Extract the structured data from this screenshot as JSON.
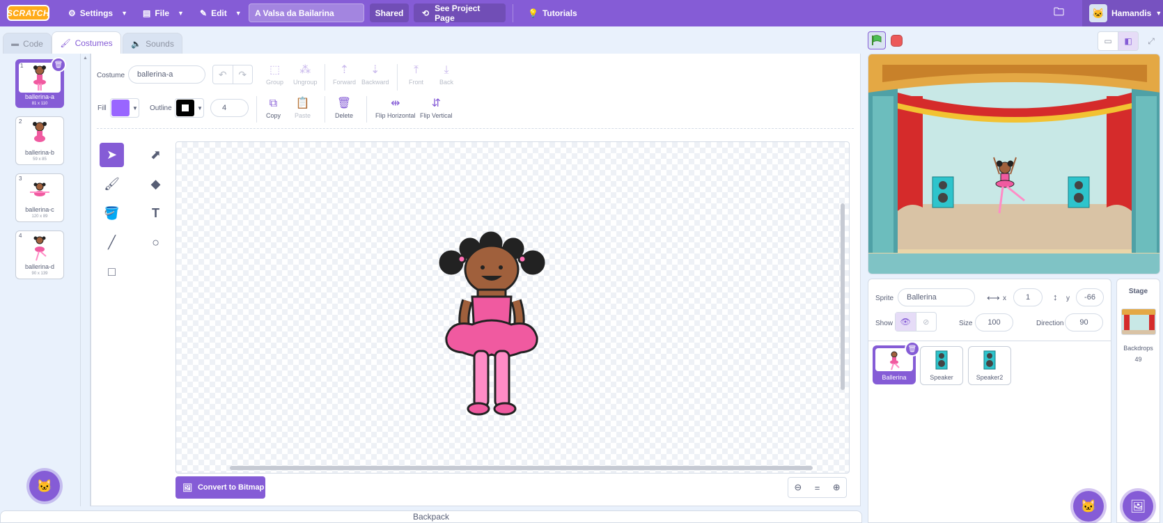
{
  "menubar": {
    "logo": "SCRATCH",
    "settings": "Settings",
    "file": "File",
    "edit": "Edit",
    "project_title": "A Valsa da Bailarina",
    "shared": "Shared",
    "see_project_page": "See Project Page",
    "tutorials": "Tutorials",
    "username": "Hamandis",
    "accent": "#855cd6"
  },
  "tabs": {
    "code": "Code",
    "costumes": "Costumes",
    "sounds": "Sounds"
  },
  "costumes": [
    {
      "num": "1",
      "name": "ballerina-a",
      "size": "81 x 110"
    },
    {
      "num": "2",
      "name": "ballerina-b",
      "size": "59 x 85"
    },
    {
      "num": "3",
      "name": "ballerina-c",
      "size": "120 x 89"
    },
    {
      "num": "4",
      "name": "ballerina-d",
      "size": "90 x 139"
    }
  ],
  "paint": {
    "costume_label": "Costume",
    "costume_name": "ballerina-a",
    "fill_label": "Fill",
    "fill_color": "#9966ff",
    "outline_label": "Outline",
    "outline_color": "#000000",
    "outline_width": "4",
    "group": "Group",
    "ungroup": "Ungroup",
    "forward": "Forward",
    "backward": "Backward",
    "front": "Front",
    "back": "Back",
    "copy": "Copy",
    "paste": "Paste",
    "delete": "Delete",
    "flip_horizontal": "Flip Horizontal",
    "flip_vertical": "Flip Vertical",
    "convert": "Convert to Bitmap"
  },
  "backpack": "Backpack",
  "sprite_info": {
    "sprite_label": "Sprite",
    "sprite_name": "Ballerina",
    "x_label": "x",
    "x": "1",
    "y_label": "y",
    "y": "-66",
    "show_label": "Show",
    "size_label": "Size",
    "size": "100",
    "direction_label": "Direction",
    "direction": "90"
  },
  "sprites": [
    {
      "name": "Ballerina"
    },
    {
      "name": "Speaker"
    },
    {
      "name": "Speaker2"
    }
  ],
  "stage_pane": {
    "title": "Stage",
    "backdrops_label": "Backdrops",
    "backdrops_count": "49"
  }
}
